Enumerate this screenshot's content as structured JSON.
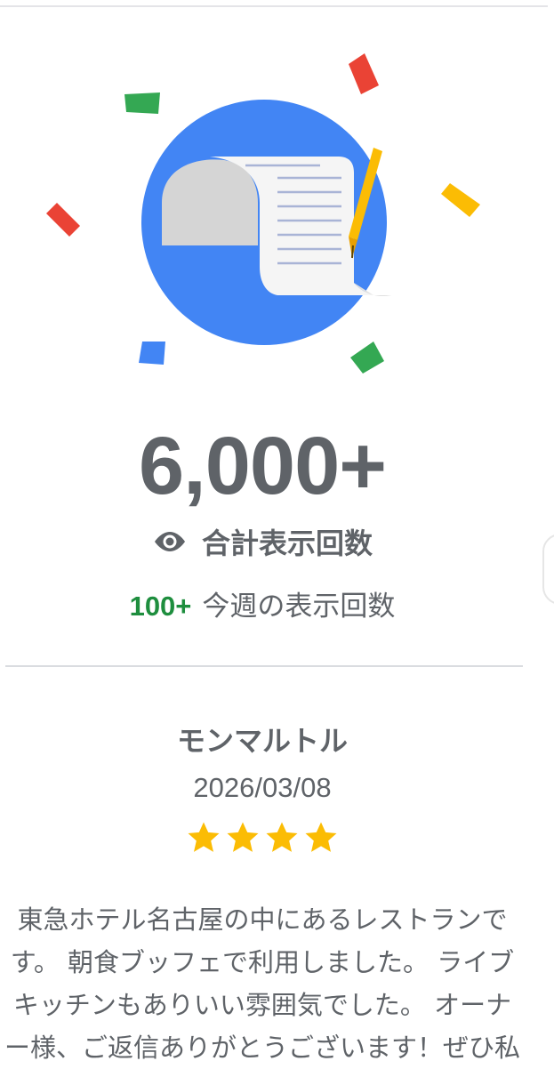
{
  "colors": {
    "blue": "#4285f4",
    "red": "#ea4335",
    "green": "#34a853",
    "yellow": "#fbbc04",
    "text": "#5f6368",
    "accent_green": "#1e8e3e"
  },
  "hero": {
    "illustration": "document-with-pen-icon",
    "confetti": [
      "red",
      "green",
      "yellow",
      "blue"
    ]
  },
  "stats": {
    "total_views": "6,000+",
    "total_label": "合計表示回数",
    "total_icon": "eye-icon",
    "week_count": "100+",
    "week_label": "今週の表示回数"
  },
  "review": {
    "name": "モンマルトル",
    "date": "2026/03/08",
    "rating": 4,
    "lines": [
      "東急ホテル名古屋の中にあるレストランで",
      "す。 朝食ブッフェで利用しました。 ライブ",
      "キッチンもありいい雰囲気でした。 オーナ",
      "ー様、ご返信ありがとうございます！ぜひ私"
    ]
  }
}
